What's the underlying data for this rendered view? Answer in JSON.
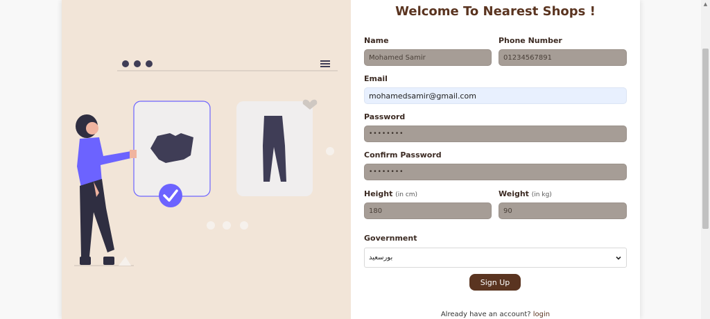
{
  "form": {
    "title": "Welcome To Nearest Shops !",
    "name_label": "Name",
    "name_value": "Mohamed Samir",
    "phone_label": "Phone Number",
    "phone_value": "01234567891",
    "email_label": "Email",
    "email_value": "mohamedsamir@gmail.com",
    "password_label": "Password",
    "password_value": "••••••••",
    "confirm_label": "Confirm Password",
    "confirm_value": "••••••••",
    "height_label": "Height",
    "height_unit": "(in cm)",
    "height_value": "180",
    "weight_label": "Weight",
    "weight_unit": "(in kg)",
    "weight_value": "90",
    "government_label": "Government",
    "government_value": "بورسعيد",
    "submit_label": "Sign Up",
    "footer_text": "Already have an account?",
    "login_link": "login"
  },
  "colors": {
    "accent": "#5a3420",
    "illustration_bg": "#f2e5d8",
    "check_purple": "#6c63ff",
    "field_fill": "#a69d96",
    "email_fill": "#e8f0fe"
  },
  "icons": [
    "menu-icon",
    "heart-icon",
    "check-icon",
    "chevron-down-icon"
  ]
}
